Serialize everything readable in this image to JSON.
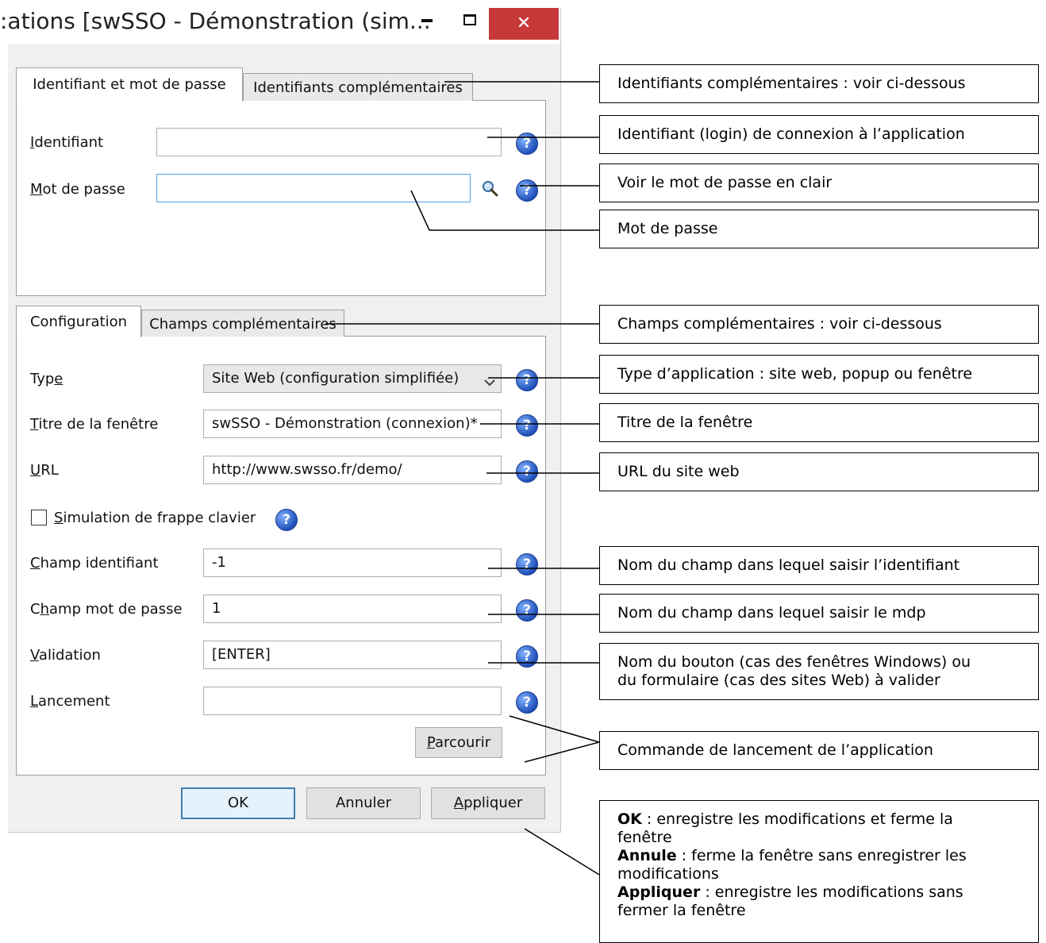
{
  "window": {
    "title": ":ations [swSSO - Démonstration (sim...",
    "controls": {
      "minimize": "–",
      "maximize": "☐",
      "close": "✕"
    }
  },
  "top_tabs": [
    "Identifiant et mot de passe",
    "Identifiants complémentaires"
  ],
  "login": {
    "identifiant_label": "Identifiant",
    "identifiant_value": "",
    "password_label": "Mot de passe",
    "password_value": ""
  },
  "config_tabs": [
    "Configuration",
    "Champs complémentaires"
  ],
  "config": {
    "type_label": "Type",
    "type_value": "Site Web (configuration simplifiée)",
    "window_title_label": "Titre de la fenêtre",
    "window_title_value": "swSSO - Démonstration (connexion)*",
    "url_label": "URL",
    "url_value": "http://www.swsso.fr/demo/",
    "simulation_label": "Simulation de frappe clavier",
    "simulation_checked": false,
    "champ_id_label": "Champ identifiant",
    "champ_id_value": "-1",
    "champ_mdp_label": "Champ mot de passe",
    "champ_mdp_value": "1",
    "validation_label": "Validation",
    "validation_value": "[ENTER]",
    "lancement_label": "Lancement",
    "lancement_value": "",
    "browse_label": "Parcourir"
  },
  "buttons": {
    "ok": "OK",
    "cancel": "Annuler",
    "apply": "Appliquer"
  },
  "help_glyph": "?",
  "search_glyph": "🔍",
  "callouts": {
    "ident_compl": "Identifiants complémentaires : voir ci-dessous",
    "identifiant": "Identifiant (login) de connexion à l’application",
    "voir_mdp": "Voir le mot de passe en clair",
    "mdp": "Mot de passe",
    "champs_compl": "Champs complémentaires : voir ci-dessous",
    "type": "Type d’application : site web, popup ou fenêtre",
    "titre": "Titre de la fenêtre",
    "url": "URL du site web",
    "nom_champ_id": "Nom du champ dans lequel saisir l’identifiant",
    "nom_champ_mdp": "Nom du champ dans lequel saisir le mdp",
    "nom_bouton_1": "Nom du bouton (cas des fenêtres Windows) ou",
    "nom_bouton_2": "du formulaire (cas des sites Web) à valider",
    "commande": "Commande de lancement de l’application",
    "ok_bold": "OK",
    "ok_text_1": " : enregistre les modifications et ferme la",
    "ok_text_2": "fenêtre",
    "annule_bold": "Annule",
    "annule_text_1": " : ferme la fenêtre sans enregistrer les",
    "annule_text_2": "modifications",
    "appliquer_bold": "Appliquer",
    "appliquer_text_1": " : enregistre les modifications sans",
    "appliquer_text_2": "fermer la fenêtre"
  }
}
